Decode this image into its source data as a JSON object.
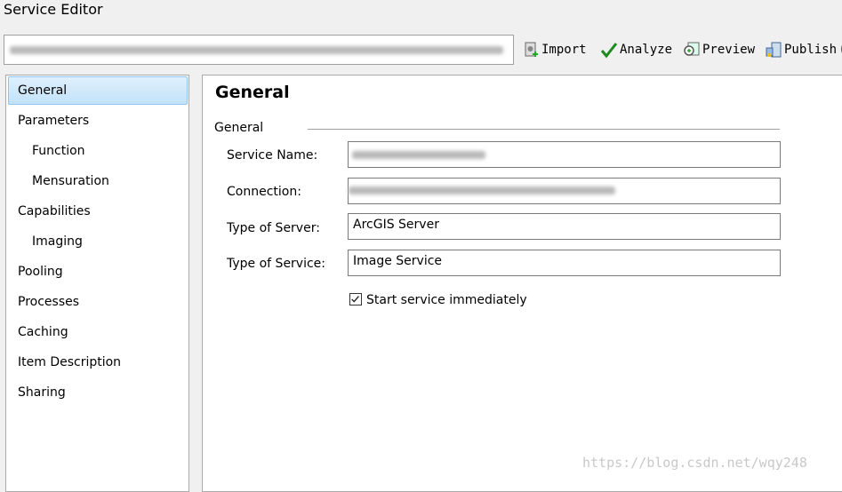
{
  "window": {
    "title": "Service Editor"
  },
  "toolbar": {
    "import": "Import",
    "analyze": "Analyze",
    "preview": "Preview",
    "publish": "Publish"
  },
  "sidebar": {
    "items": [
      {
        "label": "General",
        "selected": true
      },
      {
        "label": "Parameters"
      },
      {
        "label": "Function",
        "indent": true
      },
      {
        "label": "Mensuration",
        "indent": true
      },
      {
        "label": "Capabilities"
      },
      {
        "label": "Imaging",
        "indent": true
      },
      {
        "label": "Pooling"
      },
      {
        "label": "Processes"
      },
      {
        "label": "Caching"
      },
      {
        "label": "Item Description"
      },
      {
        "label": "Sharing"
      }
    ]
  },
  "main": {
    "title": "General",
    "group": "General",
    "fields": {
      "service_name": {
        "label": "Service Name:"
      },
      "connection": {
        "label": "Connection:"
      },
      "server_type": {
        "label": "Type of Server:",
        "value": "ArcGIS Server"
      },
      "service_type": {
        "label": "Type of Service:",
        "value": "Image Service"
      }
    },
    "start_immediately": {
      "label": "Start service immediately",
      "checked": true
    }
  },
  "watermark": "https://blog.csdn.net/wqy248"
}
